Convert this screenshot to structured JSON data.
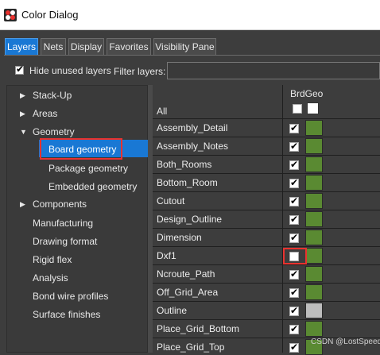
{
  "window": {
    "title": "Color Dialog",
    "icon": "color-dialog-icon"
  },
  "tabs": [
    {
      "label": "Layers",
      "active": true
    },
    {
      "label": "Nets",
      "active": false
    },
    {
      "label": "Display",
      "active": false
    },
    {
      "label": "Favorites",
      "active": false
    },
    {
      "label": "Visibility Pane",
      "active": false
    }
  ],
  "options": {
    "hide_unused_label": "Hide unused layers",
    "hide_unused_checked": true,
    "filter_label": "Filter layers:",
    "filter_value": ""
  },
  "tree": {
    "items": [
      {
        "label": "Stack-Up",
        "expander": "collapsed"
      },
      {
        "label": "Areas",
        "expander": "collapsed"
      },
      {
        "label": "Geometry",
        "expander": "expanded"
      },
      {
        "label": "Board geometry",
        "level": 2,
        "selected": true
      },
      {
        "label": "Package geometry",
        "level": 2
      },
      {
        "label": "Embedded geometry",
        "level": 2
      },
      {
        "label": "Components",
        "expander": "collapsed"
      },
      {
        "label": "Manufacturing"
      },
      {
        "label": "Drawing format"
      },
      {
        "label": "Rigid flex"
      },
      {
        "label": "Analysis"
      },
      {
        "label": "Bond wire profiles"
      },
      {
        "label": "Surface finishes"
      }
    ]
  },
  "layers": {
    "column_header": "BrdGeo",
    "all_label": "All",
    "rows": [
      {
        "name": "Assembly_Detail",
        "checked": true,
        "color": "#5a8a32"
      },
      {
        "name": "Assembly_Notes",
        "checked": true,
        "color": "#5a8a32"
      },
      {
        "name": "Both_Rooms",
        "checked": true,
        "color": "#5a8a32"
      },
      {
        "name": "Bottom_Room",
        "checked": true,
        "color": "#5a8a32"
      },
      {
        "name": "Cutout",
        "checked": true,
        "color": "#5a8a32"
      },
      {
        "name": "Design_Outline",
        "checked": true,
        "color": "#5a8a32"
      },
      {
        "name": "Dimension",
        "checked": true,
        "color": "#5a8a32"
      },
      {
        "name": "Dxf1",
        "checked": false,
        "color": "#5a8a32"
      },
      {
        "name": "Ncroute_Path",
        "checked": true,
        "color": "#5a8a32"
      },
      {
        "name": "Off_Grid_Area",
        "checked": true,
        "color": "#5a8a32"
      },
      {
        "name": "Outline",
        "checked": true,
        "color": "#bdbdbd"
      },
      {
        "name": "Place_Grid_Bottom",
        "checked": true,
        "color": "#5a8a32"
      },
      {
        "name": "Place_Grid_Top",
        "checked": true,
        "color": "#5a8a32"
      }
    ]
  },
  "watermark": "CSDN @LostSpeed",
  "colors": {
    "accent": "#1978d4",
    "highlight_border": "#e8322f",
    "background": "#3d3d3d"
  }
}
